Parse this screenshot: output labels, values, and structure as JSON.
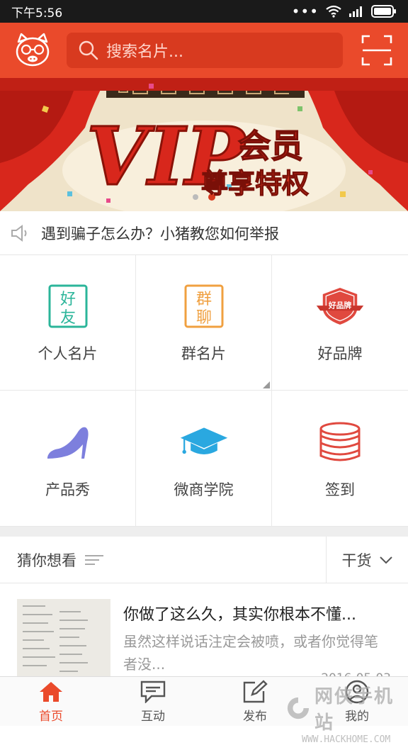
{
  "status": {
    "time": "下午5:56"
  },
  "search": {
    "placeholder": "搜索名片..."
  },
  "banner": {
    "title": "VIP",
    "subtitle1": "会员",
    "subtitle2": "尊享特权"
  },
  "notice": {
    "text": "遇到骗子怎么办？小猪教您如何举报"
  },
  "grid": [
    {
      "label": "个人名片",
      "icon": "haoyou-icon",
      "glyph": [
        "好",
        "友"
      ]
    },
    {
      "label": "群名片",
      "icon": "qunliao-icon",
      "glyph": [
        "群",
        "聊"
      ]
    },
    {
      "label": "好品牌",
      "icon": "brand-badge-icon",
      "glyph": [
        "好品牌"
      ]
    },
    {
      "label": "产品秀",
      "icon": "high-heel-icon"
    },
    {
      "label": "微商学院",
      "icon": "graduation-cap-icon"
    },
    {
      "label": "签到",
      "icon": "coins-icon"
    }
  ],
  "section": {
    "title": "猜你想看",
    "filter": "干货"
  },
  "article": {
    "title": "你做了这么久，其实你根本不懂...",
    "desc": "虽然这样说话注定会被喷，或者你觉得笔者没...",
    "date": "2016-05-03"
  },
  "tabs": [
    {
      "label": "首页",
      "icon": "home-icon"
    },
    {
      "label": "互动",
      "icon": "chat-icon"
    },
    {
      "label": "发布",
      "icon": "edit-icon"
    },
    {
      "label": "我的",
      "icon": "profile-icon"
    }
  ],
  "watermark": {
    "big": "网侠手机站",
    "small": "WWW.HACKHOME.COM"
  },
  "colors": {
    "accent": "#ea4a2b",
    "green": "#2bb59a",
    "orange": "#f0a040",
    "red": "#e0493f",
    "purple": "#7d7fdd",
    "blue": "#2aa8e0"
  }
}
